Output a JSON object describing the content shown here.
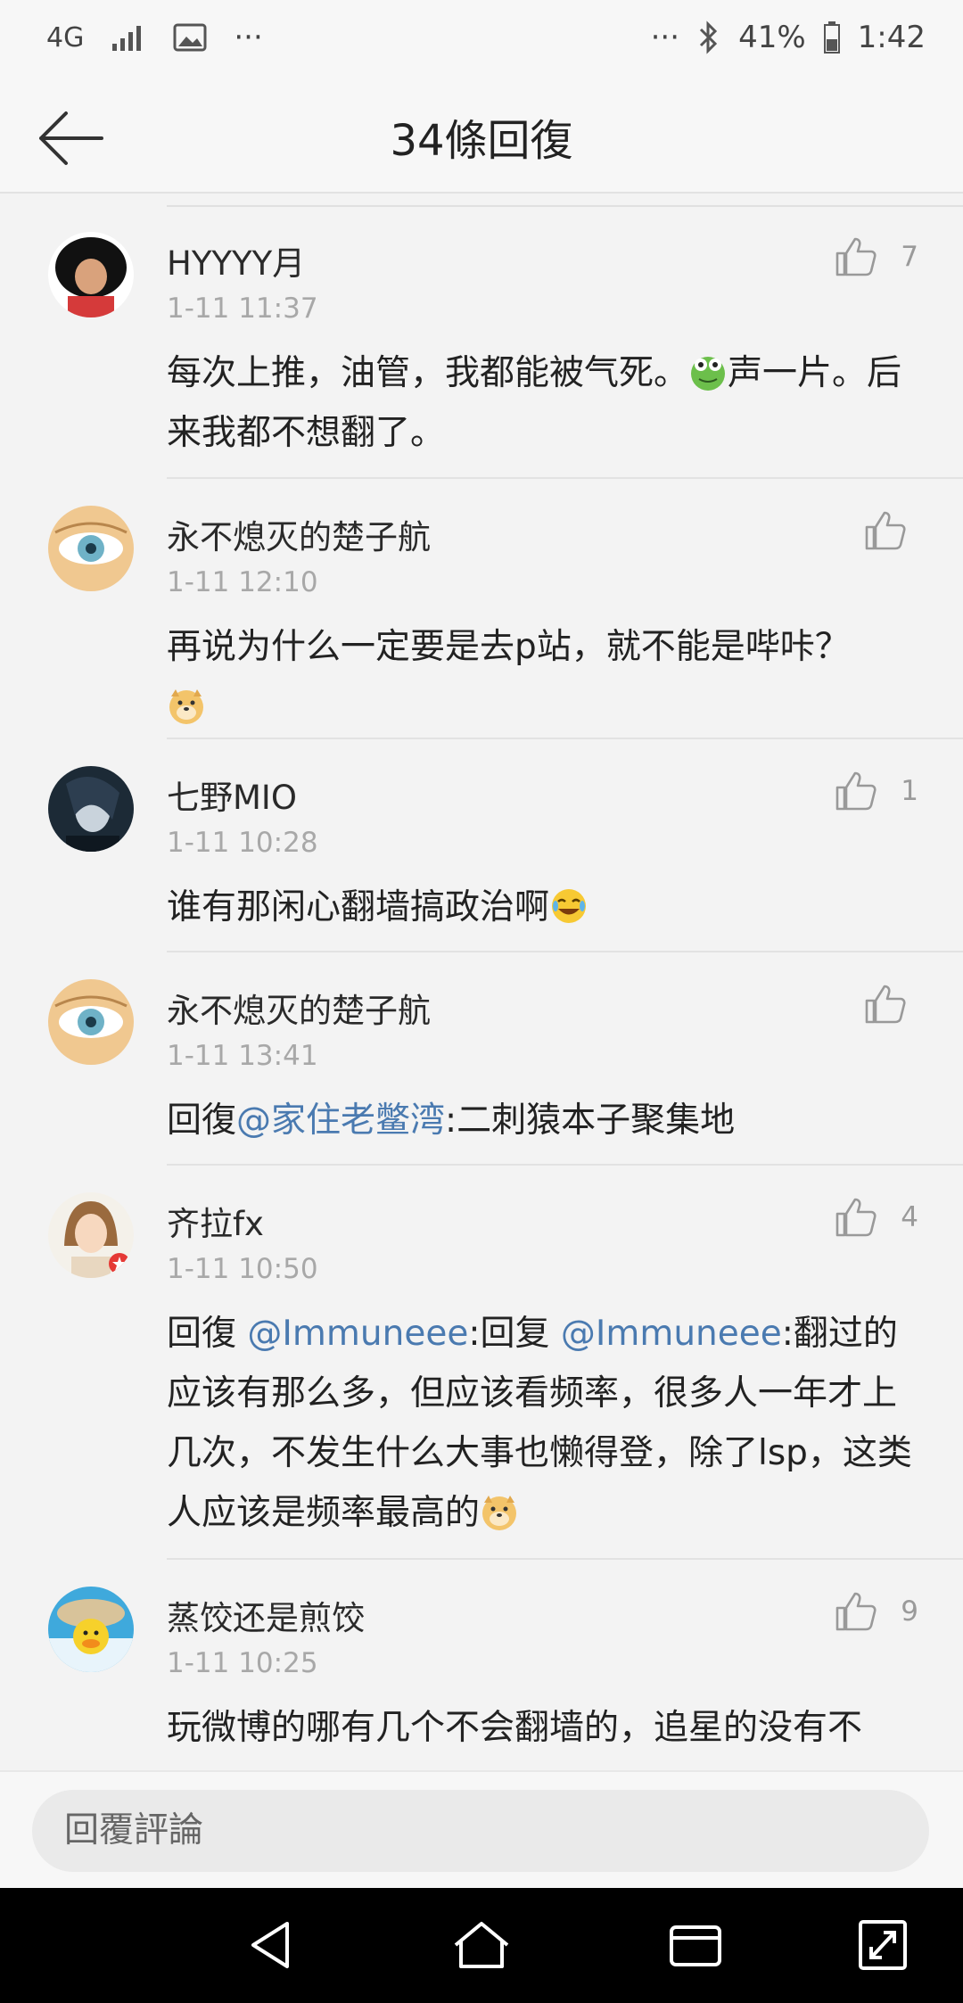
{
  "status_bar": {
    "network": "4G",
    "more_left": "···",
    "more_right": "···",
    "battery": "41%",
    "time": "1:42"
  },
  "header": {
    "title": "34條回復"
  },
  "comments": [
    {
      "user": "HYYYY月",
      "time": "1-11 11:37",
      "likes": "7",
      "text_parts": [
        "每次上推，油管，我都能被气死。",
        "声一片。后来我都不想翻了。"
      ],
      "emoji_after": "frog-emoji"
    },
    {
      "user": "永不熄灭的楚子航",
      "time": "1-11 12:10",
      "likes": "",
      "text": "再说为什么一定要是去p站，就不能是哔咔？",
      "emoji_after": "doge-emoji"
    },
    {
      "user": "七野MIO",
      "time": "1-11 10:28",
      "likes": "1",
      "text": "谁有那闲心翻墙搞政治啊",
      "emoji_after": "laugh-cry-emoji"
    },
    {
      "user": "永不熄灭的楚子航",
      "time": "1-11 13:41",
      "likes": "",
      "reply_prefix": "回復",
      "mention": "@家住老鳖湾",
      "text": ":二刺猿本子聚集地"
    },
    {
      "user": "齐拉fx",
      "time": "1-11 10:50",
      "likes": "4",
      "reply_prefix": "回復 ",
      "mention": "@Immuneee",
      "mid": ":回复 ",
      "mention2": "@Immuneee",
      "text": ":翻过的应该有那么多，但应该看频率，很多人一年才上几次，不发生什么大事也懒得登，除了lsp，这类人应该是频率最高的",
      "emoji_after": "doge-emoji"
    },
    {
      "user": "蒸饺还是煎饺",
      "time": "1-11 10:25",
      "likes": "9",
      "text": "玩微博的哪有几个不会翻墙的，追星的没有不"
    }
  ],
  "reply_bar": {
    "placeholder": "回覆評論"
  },
  "colors": {
    "mention": "#4a7ab0",
    "background": "#f3f3f3",
    "nav_bar": "#000000"
  }
}
